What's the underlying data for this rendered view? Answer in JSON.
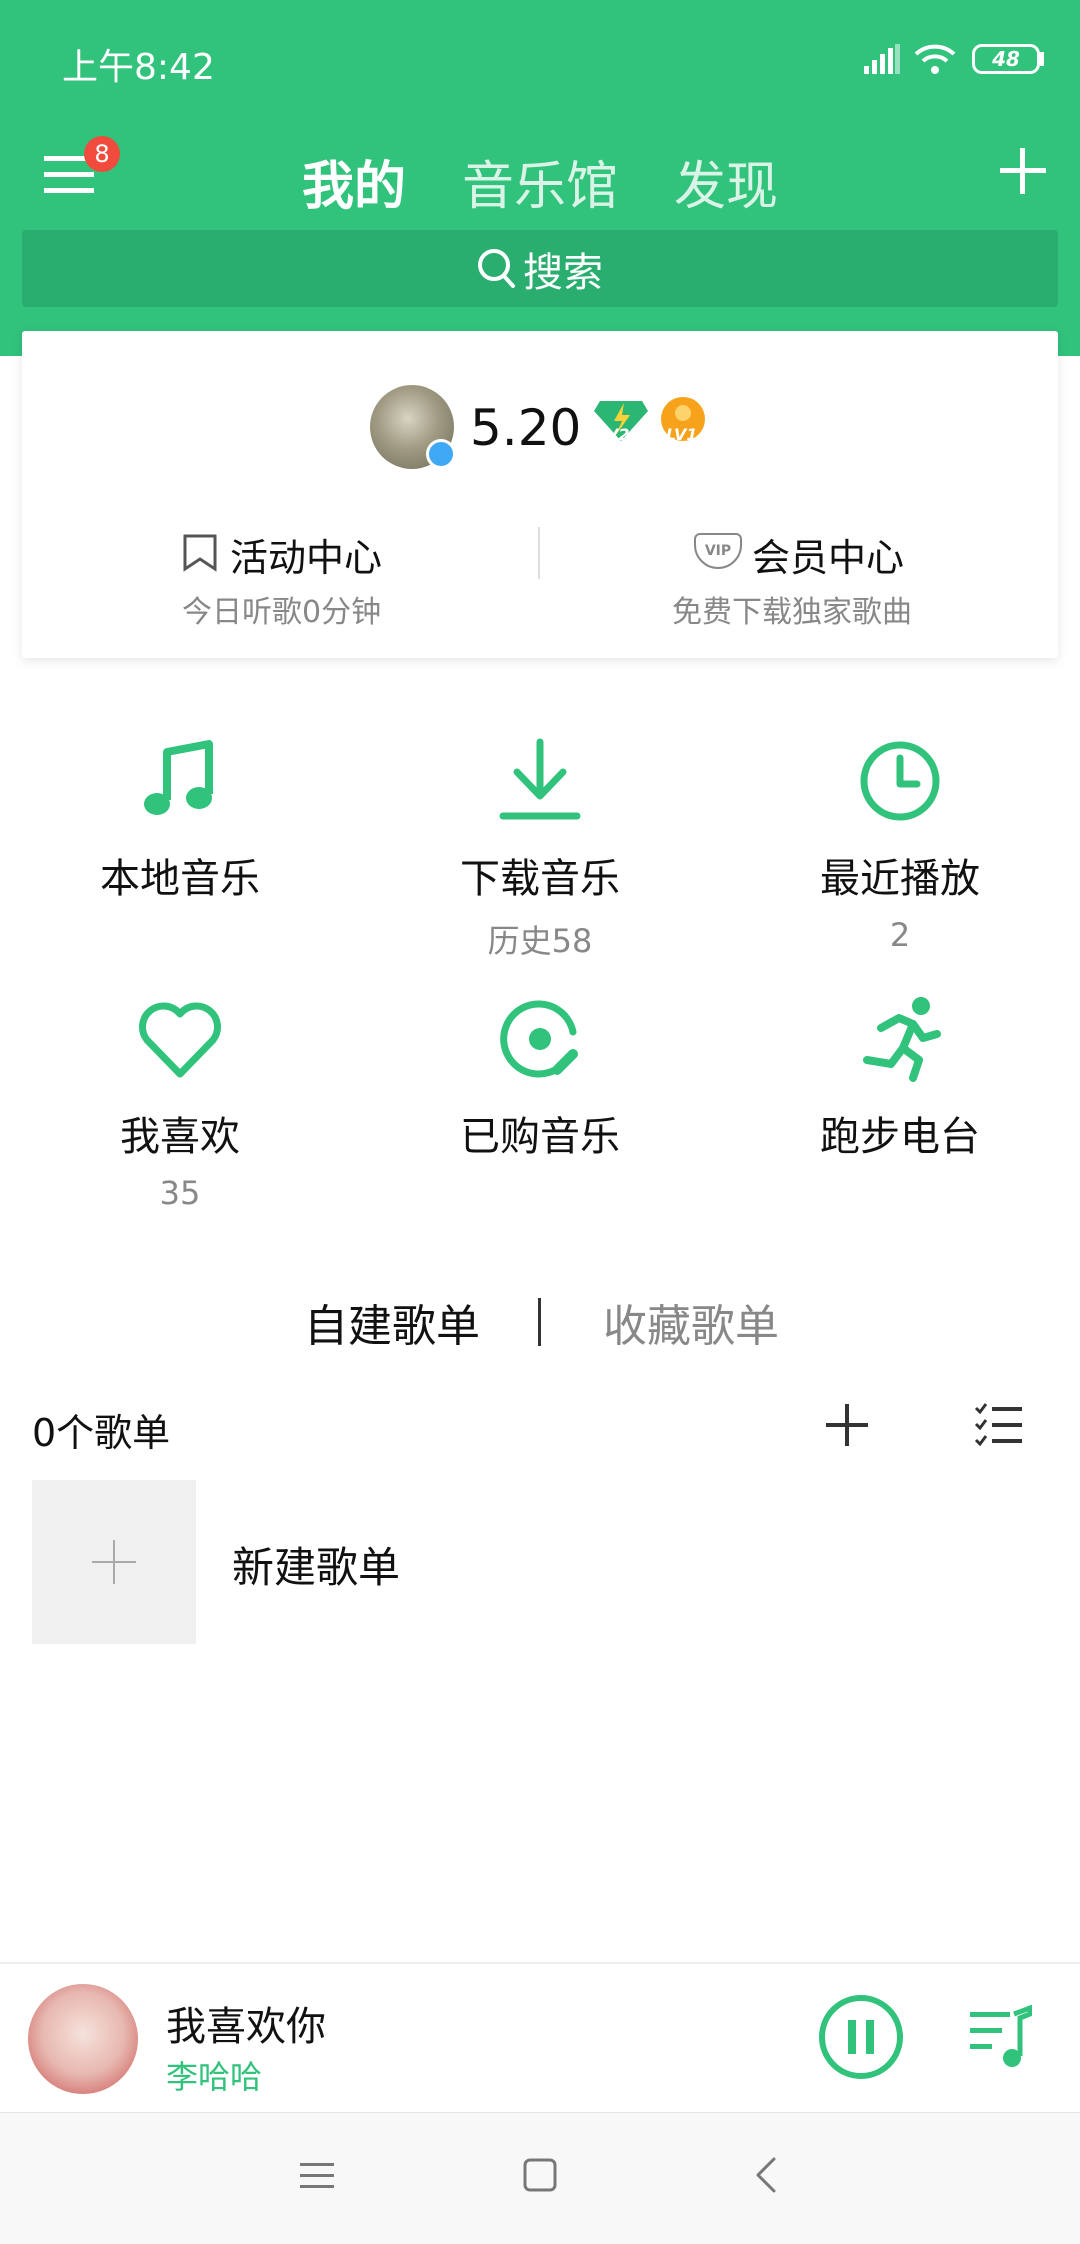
{
  "status_bar": {
    "time": "上午8:42",
    "battery": "48"
  },
  "header": {
    "menu_badge": "8",
    "tabs": [
      {
        "label": "我的",
        "active": true
      },
      {
        "label": "音乐馆",
        "active": false
      },
      {
        "label": "发现",
        "active": false
      }
    ],
    "search_placeholder": "搜索"
  },
  "profile": {
    "score": "5.20",
    "badges": [
      "LV2",
      "LV1"
    ],
    "activity": {
      "title": "活动中心",
      "subtitle": "今日听歌0分钟"
    },
    "vip": {
      "icon_text": "VIP",
      "title": "会员中心",
      "subtitle": "免费下载独家歌曲"
    }
  },
  "grid": [
    {
      "label": "本地音乐",
      "sub": "",
      "icon": "music-note-icon"
    },
    {
      "label": "下载音乐",
      "sub": "历史58",
      "icon": "download-icon"
    },
    {
      "label": "最近播放",
      "sub": "2",
      "icon": "clock-icon"
    },
    {
      "label": "我喜欢",
      "sub": "35",
      "icon": "heart-icon"
    },
    {
      "label": "已购音乐",
      "sub": "",
      "icon": "disc-icon"
    },
    {
      "label": "跑步电台",
      "sub": "",
      "icon": "running-icon"
    }
  ],
  "playlists": {
    "tabs": [
      {
        "label": "自建歌单",
        "active": true
      },
      {
        "label": "收藏歌单",
        "active": false
      }
    ],
    "count_label": "0个歌单",
    "new_label": "新建歌单"
  },
  "player": {
    "title": "我喜欢你",
    "artist": "李哈哈"
  },
  "colors": {
    "brand": "#31c27c",
    "search_bg": "#2aae6f",
    "badge": "#f04b3c",
    "grey_text": "#888888"
  }
}
